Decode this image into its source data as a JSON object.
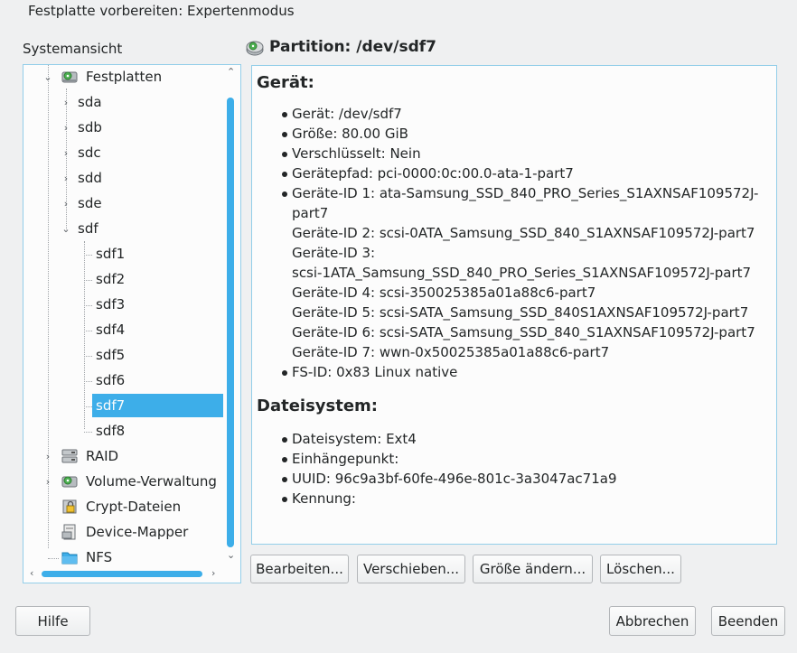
{
  "window": {
    "title": "Festplatte vorbereiten: Expertenmodus"
  },
  "tree": {
    "label": "Systemansicht",
    "root": "Festplatten",
    "disks": [
      "sda",
      "sdb",
      "sdc",
      "sdd",
      "sde",
      "sdf"
    ],
    "partitions": [
      "sdf1",
      "sdf2",
      "sdf3",
      "sdf4",
      "sdf5",
      "sdf6",
      "sdf7",
      "sdf8"
    ],
    "selected": "sdf7",
    "others": [
      "RAID",
      "Volume-Verwaltung",
      "Crypt-Dateien",
      "Device-Mapper",
      "NFS"
    ]
  },
  "partition": {
    "title": "Partition: /dev/sdf7"
  },
  "device_section": {
    "heading": "Gerät:",
    "device": "Gerät: /dev/sdf7",
    "size": "Größe: 80.00 GiB",
    "encrypted": "Verschlüsselt: Nein",
    "path": "Gerätepfad: pci-0000:0c:00.0-ata-1-part7",
    "id1a": "Geräte-ID 1: ata-Samsung_SSD_840_PRO_Series_S1AXNSAF109572J-",
    "id1b": "part7",
    "id2": "Geräte-ID 2: scsi-0ATA_Samsung_SSD_840_S1AXNSAF109572J-part7",
    "id3a": "Geräte-ID 3:",
    "id3b": "scsi-1ATA_Samsung_SSD_840_PRO_Series_S1AXNSAF109572J-part7",
    "id4": "Geräte-ID 4: scsi-350025385a01a88c6-part7",
    "id5": "Geräte-ID 5: scsi-SATA_Samsung_SSD_840S1AXNSAF109572J-part7",
    "id6": "Geräte-ID 6: scsi-SATA_Samsung_SSD_840_S1AXNSAF109572J-part7",
    "id7": "Geräte-ID 7: wwn-0x50025385a01a88c6-part7",
    "fsid": "FS-ID: 0x83 Linux native"
  },
  "fs_section": {
    "heading": "Dateisystem:",
    "fs": "Dateisystem: Ext4",
    "mount": "Einhängepunkt:",
    "uuid": "UUID: 96c9a3bf-60fe-496e-801c-3a3047ac71a9",
    "label": "Kennung:"
  },
  "actions": {
    "edit": "Bearbeiten...",
    "move": "Verschieben...",
    "resize": "Größe ändern...",
    "delete": "Löschen..."
  },
  "footer": {
    "help": "Hilfe",
    "cancel": "Abbrechen",
    "finish": "Beenden"
  },
  "colors": {
    "accent": "#3daee9",
    "border": "#93cee9",
    "window_bg": "#eff0f1"
  }
}
